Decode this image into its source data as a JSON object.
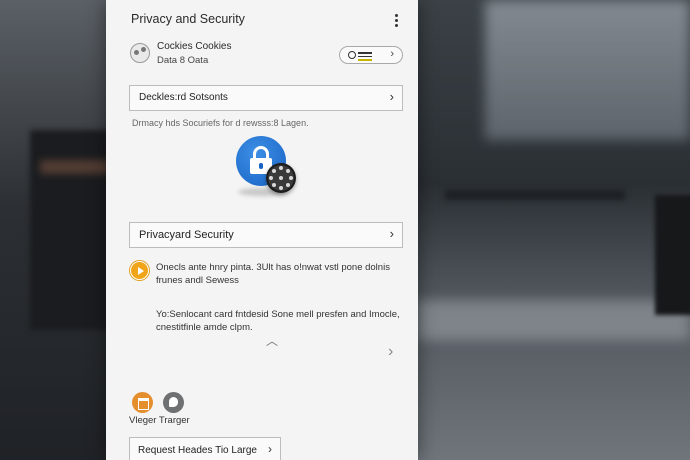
{
  "header": {
    "title": "Privacy and Security"
  },
  "cookies": {
    "title": "Cockies Cookies",
    "subtitle": "Data 8 Oata"
  },
  "rows": {
    "first": {
      "label": "Deckles:rd Sotsonts"
    },
    "second": {
      "label": "Privacyard Security"
    }
  },
  "caption": "Drmacy hds Socuriefs for d rewsss:8 Lagen.",
  "notice": "Onecls ante hnry pinta. 3Ult has o!nwat vstl pone dolnis frunes andl Sewess",
  "description": "Yo:Senlocant card fntdesid Sone mell presfen and Imocle, cnestitfinle amde clpm.",
  "apps": {
    "label": "Vleger Trarger"
  },
  "request_button": {
    "label": "Request Heades Tio Large"
  },
  "icons": {
    "menu": "more-vert-icon",
    "cookie": "cookie-icon",
    "search": "search-icon",
    "lock": "lock-icon",
    "gear": "gear-icon",
    "play": "play-icon"
  },
  "colors": {
    "accent_blue": "#1762c4",
    "warning_orange": "#f0a418",
    "app_orange": "#e58e2e"
  }
}
